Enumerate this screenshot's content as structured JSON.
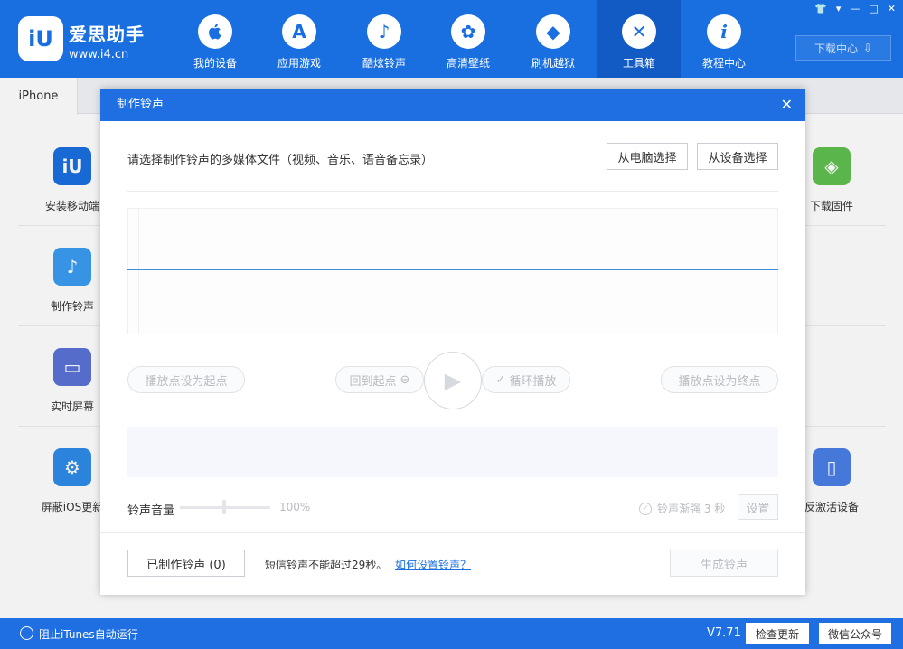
{
  "app": {
    "name": "爱思助手",
    "url": "www.i4.cn",
    "logo_text": "iU",
    "accent": "#1a6fe0"
  },
  "nav": [
    {
      "label": "我的设备",
      "icon": "apple-icon",
      "glyph": ""
    },
    {
      "label": "应用游戏",
      "icon": "app-store-icon",
      "glyph": "A"
    },
    {
      "label": "酷炫铃声",
      "icon": "bell-icon",
      "glyph": "♪"
    },
    {
      "label": "高清壁纸",
      "icon": "flower-icon",
      "glyph": "✿"
    },
    {
      "label": "刷机越狱",
      "icon": "dropbox-icon",
      "glyph": "◆"
    },
    {
      "label": "工具箱",
      "icon": "tools-icon",
      "glyph": "✕"
    },
    {
      "label": "教程中心",
      "icon": "info-icon",
      "glyph": "i"
    }
  ],
  "download_center": "下载中心",
  "tab": "iPhone",
  "tools_left": [
    {
      "label": "安装移动端",
      "icon": "i4-app-icon",
      "color": "#1a6fe0",
      "glyph": "iU"
    },
    {
      "label": "制作铃声",
      "icon": "bell-icon",
      "color": "#3a9bf0",
      "glyph": "♪"
    },
    {
      "label": "实时屏幕",
      "icon": "monitor-icon",
      "color": "#5a72d6",
      "glyph": "▭"
    },
    {
      "label": "屏蔽iOS更新",
      "icon": "settings-icon",
      "color": "#2f8be8",
      "glyph": "⚙"
    }
  ],
  "tools_right": [
    {
      "label": "下载固件",
      "icon": "cube-icon",
      "color": "#5fc04e",
      "glyph": "◈"
    },
    {
      "label": "反激活设备",
      "icon": "tablet-icon",
      "color": "#4a7fe6",
      "glyph": "▯"
    }
  ],
  "dialog": {
    "title": "制作铃声",
    "prompt": "请选择制作铃声的多媒体文件（视频、音乐、语音备忘录）",
    "from_pc": "从电脑选择",
    "from_device": "从设备选择",
    "set_start": "播放点设为起点",
    "back_to_start": "回到起点",
    "loop_play": "循环播放",
    "set_end": "播放点设为终点",
    "volume_label": "铃声音量",
    "volume_pct": "100%",
    "fade_label": "铃声渐强 3 秒",
    "settings": "设置",
    "made_ringtones": "已制作铃声 (0)",
    "limit_note": "短信铃声不能超过29秒。",
    "howto_link": "如何设置铃声？",
    "generate": "生成铃声"
  },
  "status": {
    "itunes": "阻止iTunes自动运行",
    "version": "V7.71",
    "check_update": "检查更新",
    "wechat": "微信公众号"
  }
}
